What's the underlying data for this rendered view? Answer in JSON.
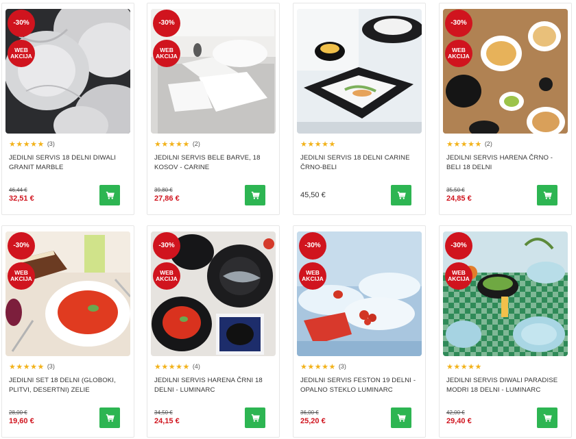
{
  "products": [
    {
      "title": "JEDILNI SERVIS 18 DELNI DIWALI GRANIT MARBLE",
      "rating_stars": "★★★★★",
      "rating_count": "(3)",
      "old_price": "46,44 €",
      "price": "32,51 €",
      "discount": "-30%",
      "web_badge": [
        "WEB",
        "AKCIJA"
      ],
      "image": "grey-marble-plates"
    },
    {
      "title": "JEDILNI SERVIS BELE BARVE, 18 KOSOV - CARINE",
      "rating_stars": "★★★★★",
      "rating_count": "(2)",
      "old_price": "39,80 €",
      "price": "27,86 €",
      "discount": "-30%",
      "web_badge": [
        "WEB",
        "AKCIJA"
      ],
      "image": "white-square-plates"
    },
    {
      "title": "JEDILNI SERVIS 18 DELNI CARINE ČRNO-BELI",
      "rating_stars": "★★★★★",
      "rating_count": "",
      "old_price": "",
      "price": "45,50 €",
      "discount": "",
      "web_badge": [],
      "image": "black-white-plates"
    },
    {
      "title": "JEDILNI SERVIS HARENA ČRNO - BELI 18 DELNI",
      "rating_stars": "★★★★★",
      "rating_count": "(2)",
      "old_price": "35,50 €",
      "price": "24,85 €",
      "discount": "-30%",
      "web_badge": [
        "WEB",
        "AKCIJA"
      ],
      "image": "wooden-table-dinner"
    },
    {
      "title": "JEDILNI SET 18 DELNI (GLOBOKI, PLITVI, DESERTNI) ZELIE",
      "rating_stars": "★★★★★",
      "rating_count": "(3)",
      "old_price": "28,00 €",
      "price": "19,60 €",
      "discount": "-30%",
      "web_badge": [
        "WEB",
        "AKCIJA"
      ],
      "image": "tomato-soup"
    },
    {
      "title": "JEDILNI SERVIS HARENA ČRNI 18 DELNI - LUMINARC",
      "rating_stars": "★★★★★",
      "rating_count": "(4)",
      "old_price": "34,50 €",
      "price": "24,15 €",
      "discount": "-30%",
      "web_badge": [
        "WEB",
        "AKCIJA"
      ],
      "image": "black-plates-fish"
    },
    {
      "title": "JEDILNI SERVIS FESTON 19 DELNI - OPALNO STEKLO LUMINARC",
      "rating_stars": "★★★★★",
      "rating_count": "(3)",
      "old_price": "36,00 €",
      "price": "25,20 €",
      "discount": "-30%",
      "web_badge": [
        "WEB",
        "AKCIJA"
      ],
      "image": "blue-feston-plates"
    },
    {
      "title": "JEDILNI SERVIS DIWALI PARADISE MODRI 18 DELNI - LUMINARC",
      "rating_stars": "★★★★★",
      "rating_count": "",
      "old_price": "42,00 €",
      "price": "29,40 €",
      "discount": "-30%",
      "web_badge": [
        "WEB",
        "AKCIJA"
      ],
      "image": "checkered-table"
    }
  ],
  "colors": {
    "discount_red": "#d0141e",
    "cart_green": "#2db552",
    "star_gold": "#f2b21a"
  },
  "icons": {
    "cart": "shopping-cart-icon",
    "star": "star-icon"
  }
}
